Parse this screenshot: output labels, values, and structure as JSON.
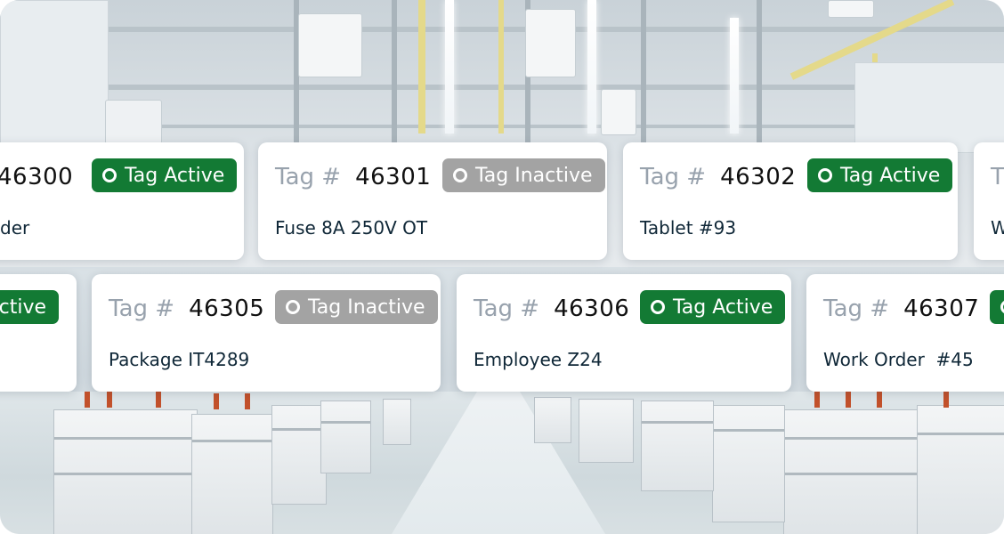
{
  "status_labels": {
    "active": "Tag Active",
    "inactive": "Tag Inactive"
  },
  "tag_prefix": "Tag #",
  "colors": {
    "active": "#137a34",
    "inactive": "#a3a3a3",
    "card_bg": "#ffffff",
    "name_text": "#0f2737"
  },
  "icons": {
    "status": "circle-ring-icon"
  },
  "row1": [
    {
      "number": "46300",
      "status": "Tag Active",
      "name": "der"
    },
    {
      "number": "46301",
      "status": "Tag Inactive",
      "name": "Fuse 8A 250V OT"
    },
    {
      "number": "46302",
      "status": "Tag Active",
      "name": "Tablet #93"
    },
    {
      "prefix": "T",
      "name": "W"
    }
  ],
  "row2": [
    {
      "status": "Active"
    },
    {
      "number": "46305",
      "status": "Tag Inactive",
      "name": "Package IT4289"
    },
    {
      "number": "46306",
      "status": "Tag Active",
      "name": "Employee Z24"
    },
    {
      "number": "46307",
      "name": "Work Order  #45"
    }
  ]
}
